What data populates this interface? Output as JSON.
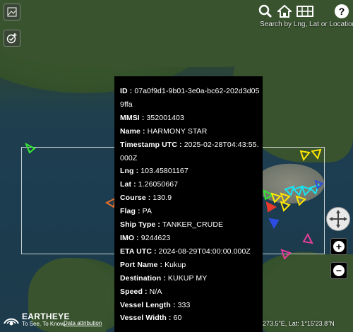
{
  "toolbar": {
    "search_caption": "Search by Lng, Lat or Location"
  },
  "popup": {
    "fields": [
      {
        "label": "ID",
        "value": "07a0f9d1-9b01-3e0a-bc62-202d3d059ffa"
      },
      {
        "label": "MMSI",
        "value": "352001403"
      },
      {
        "label": "Name",
        "value": "HARMONY STAR"
      },
      {
        "label": "Timestamp UTC",
        "value": "2025-02-28T04:43:55.000Z"
      },
      {
        "label": "Lng",
        "value": "103.45801167"
      },
      {
        "label": "Lat",
        "value": "1.26050667"
      },
      {
        "label": "Course",
        "value": "130.9"
      },
      {
        "label": "Flag",
        "value": "PA"
      },
      {
        "label": "Ship Type",
        "value": "TANKER_CRUDE"
      },
      {
        "label": "IMO",
        "value": "9244623"
      },
      {
        "label": "ETA UTC",
        "value": "2024-08-29T04:00:00.000Z"
      },
      {
        "label": "Port Name",
        "value": "Kukup"
      },
      {
        "label": "Destination",
        "value": "KUKUP MY"
      },
      {
        "label": "Speed",
        "value": "N/A"
      },
      {
        "label": "Vessel Length",
        "value": "333"
      },
      {
        "label": "Vessel Width",
        "value": "60"
      }
    ]
  },
  "branding": {
    "name": "EARTHEYE",
    "tagline": "To See, To Know."
  },
  "attribution_link": "Data attribution",
  "coordinates_readout": "273.5\"E, Lat: 1°15'23.8\"N",
  "colors": {
    "popup_bg": "#000000",
    "ship_yellow": "#ffe600",
    "ship_cyan": "#19e3f0",
    "ship_green": "#34e834",
    "ship_red": "#e83a2a",
    "ship_blue": "#2c4de0",
    "ship_magenta": "#e83d9a",
    "ship_orange": "#e8702a"
  }
}
